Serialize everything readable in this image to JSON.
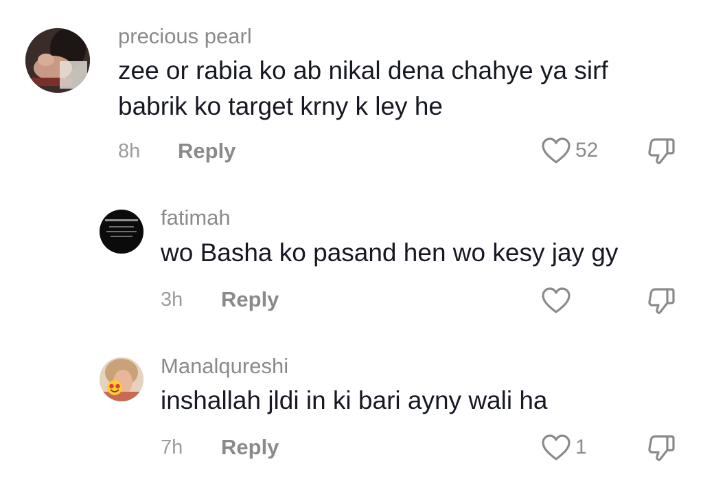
{
  "comments": [
    {
      "username": "precious pearl",
      "text_lines": [
        "zee or rabia ko ab nikal dena chahye ya sirf",
        "babrik ko target krny k ley he"
      ],
      "time": "8h",
      "reply_label": "Reply",
      "likes": "52"
    },
    {
      "username": "fatimah",
      "text_lines": [
        "wo Basha ko pasand hen wo kesy jay gy"
      ],
      "time": "3h",
      "reply_label": "Reply",
      "likes": ""
    },
    {
      "username": "Manalqureshi",
      "text_lines": [
        "inshallah jldi in ki bari ayny wali ha"
      ],
      "time": "7h",
      "reply_label": "Reply",
      "likes": "1"
    }
  ],
  "colors": {
    "text": "#161823",
    "muted": "#8a8a8a",
    "icon_stroke": "#8a8a8a"
  },
  "icons": {
    "like": "heart-outline-icon",
    "dislike": "thumbs-down-outline-icon",
    "emoji": "heart-eyes-emoji"
  }
}
